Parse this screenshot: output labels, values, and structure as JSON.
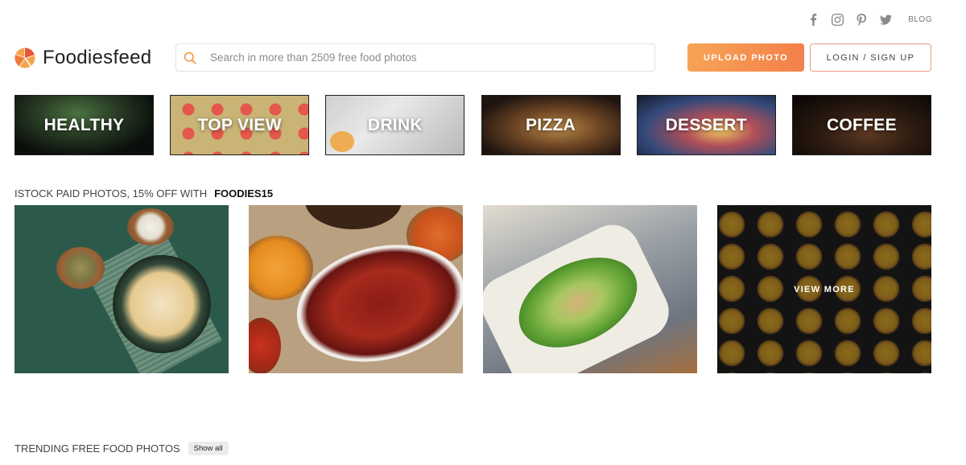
{
  "social": {
    "icons": [
      "facebook-icon",
      "instagram-icon",
      "pinterest-icon",
      "twitter-icon"
    ],
    "blog_label": "BLOG"
  },
  "header": {
    "logo_text": "Foodiesfeed",
    "search_placeholder": "Search in more than 2509 free food photos",
    "upload_label": "UPLOAD PHOTO",
    "login_label": "LOGIN / SIGN UP"
  },
  "colors": {
    "accent": "#f4894c",
    "login_border": "#ed9a86"
  },
  "categories": [
    {
      "label": "HEALTHY"
    },
    {
      "label": "TOP VIEW"
    },
    {
      "label": "DRINK"
    },
    {
      "label": "PIZZA"
    },
    {
      "label": "DESSERT"
    },
    {
      "label": "COFFEE"
    }
  ],
  "istock": {
    "heading": "ISTOCK PAID PHOTOS, 15% OFF WITH",
    "code": "FOODIES15",
    "view_more_label": "VIEW MORE"
  },
  "trending": {
    "title": "TRENDING FREE FOOD PHOTOS",
    "show_all_label": "Show all"
  }
}
